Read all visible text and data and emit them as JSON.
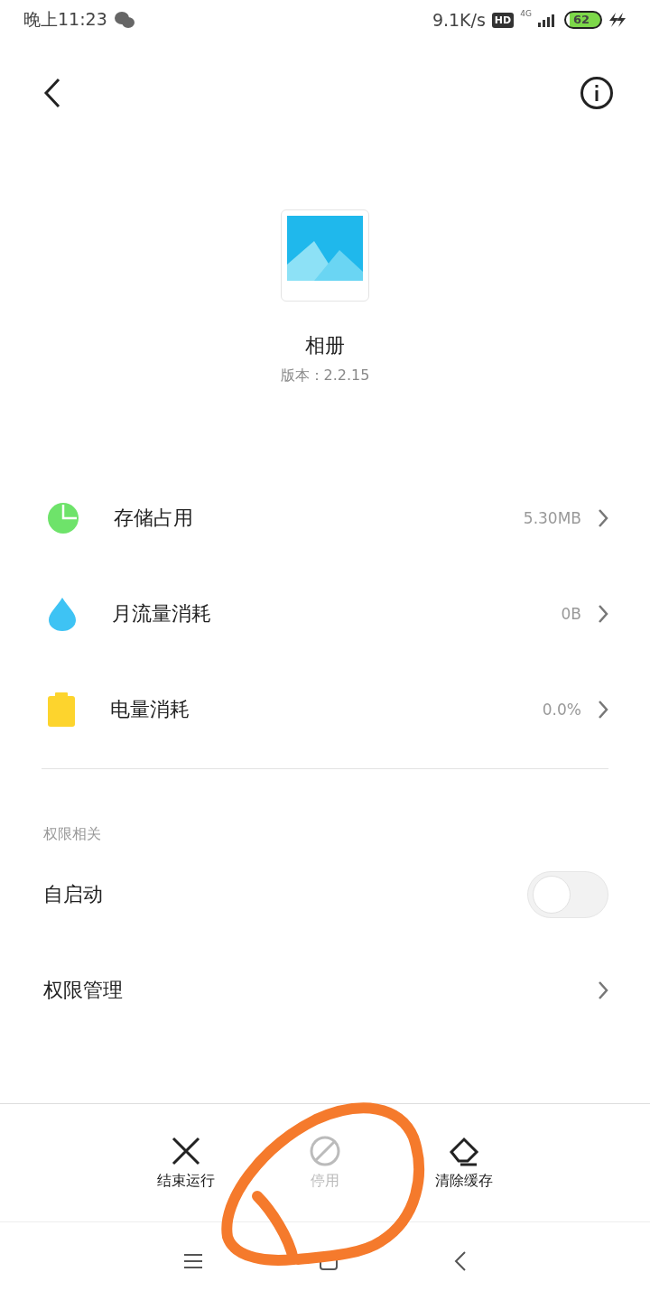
{
  "status_bar": {
    "time": "晚上11:23",
    "speed": "9.1K/s",
    "hd": "HD",
    "network": "4G",
    "battery": "62"
  },
  "app": {
    "name": "相册",
    "version": "版本：2.2.15"
  },
  "usage": [
    {
      "kind": "storage",
      "label": "存储占用",
      "value": "5.30MB"
    },
    {
      "kind": "data",
      "label": "月流量消耗",
      "value": "0B"
    },
    {
      "kind": "battery",
      "label": "电量消耗",
      "value": "0.0%"
    }
  ],
  "permissions": {
    "title": "权限相关",
    "items": [
      {
        "kind": "toggle",
        "label": "自启动",
        "on": false
      },
      {
        "kind": "link",
        "label": "权限管理"
      }
    ]
  },
  "actions": [
    {
      "kind": "stop",
      "label": "结束运行",
      "disabled": false
    },
    {
      "kind": "disable",
      "label": "停用",
      "disabled": true
    },
    {
      "kind": "clear",
      "label": "清除缓存",
      "disabled": false
    }
  ],
  "annotation": {
    "kind": "circle",
    "color": "#f57a2c"
  }
}
